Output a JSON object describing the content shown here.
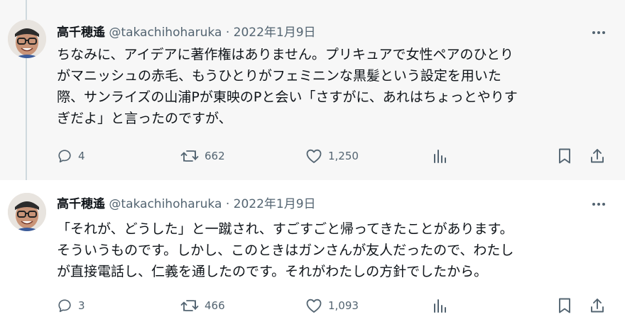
{
  "tweets": [
    {
      "name": "高千穂遙",
      "handle": "@takachihoharuka",
      "separator": "·",
      "date": "2022年1月9日",
      "text": "ちなみに、アイデアに著作権はありません。プリキュアで女性ペアのひとり\nがマニッシュの赤毛、もうひとりがフェミニンな黒髪という設定を用いた\n際、サンライズの山浦Pが東映のPと会い「さすがに、あれはちょっとやりす\nぎだよ」と言ったのですが、",
      "replies": "4",
      "retweets": "662",
      "likes": "1,250"
    },
    {
      "name": "高千穂遙",
      "handle": "@takachihoharuka",
      "separator": "·",
      "date": "2022年1月9日",
      "text": "「それが、どうした」と一蹴され、すごすごと帰ってきたことがあります。\nそういうものです。しかし、このときはガンさんが友人だったので、わたし\nが直接電話し、仁義を通したのです。それがわたしの方針でしたから。",
      "replies": "3",
      "retweets": "466",
      "likes": "1,093"
    }
  ],
  "icons": {
    "reply": "reply-icon",
    "retweet": "retweet-icon",
    "like": "heart-icon",
    "views": "views-chart-icon",
    "bookmark": "bookmark-icon",
    "share": "share-icon",
    "more": "more-dots-icon"
  },
  "colors": {
    "text": "#0f1419",
    "muted": "#536471",
    "thread_line": "#cfd9de",
    "highlight_bg": "#f7f7f7"
  }
}
